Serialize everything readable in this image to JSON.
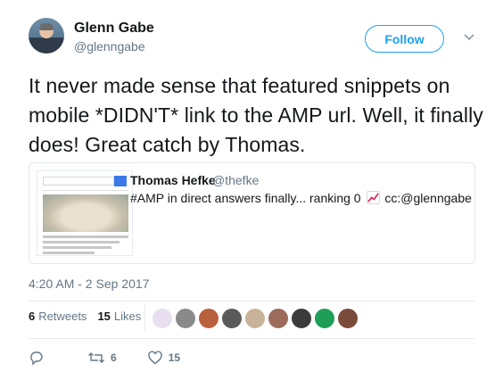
{
  "author": {
    "name": "Glenn Gabe",
    "handle": "@glenngabe"
  },
  "follow_label": "Follow",
  "tweet": {
    "text": "It never made sense that featured snippets on mobile *DIDN'T* link to the AMP url. Well, it finally does! Great catch by Thomas."
  },
  "quoted": {
    "name": "Thomas Hefke",
    "handle": "@thefke",
    "text_before": "#AMP in direct answers finally... ranking 0",
    "text_after": "cc:@glenngabe",
    "emoji_icon": "chart-increasing-icon"
  },
  "timestamp": "4:20 AM - 2 Sep 2017",
  "stats": {
    "retweets_count": "6",
    "retweets_label": "Retweets",
    "likes_count": "15",
    "likes_label": "Likes"
  },
  "liker_avatar_colors": [
    "#e8e0f0",
    "#8a8a8a",
    "#b9603f",
    "#5a5a5a",
    "#c9b29a",
    "#9c6b5a",
    "#3b3b3b",
    "#1f9e57",
    "#7a4a3a"
  ],
  "actions": {
    "reply_icon": "reply-icon",
    "retweet_icon": "retweet-icon",
    "retweet_count": "6",
    "like_icon": "heart-icon",
    "like_count": "15"
  },
  "colors": {
    "accent": "#1da1f2",
    "muted": "#657786",
    "text": "#14171a"
  }
}
